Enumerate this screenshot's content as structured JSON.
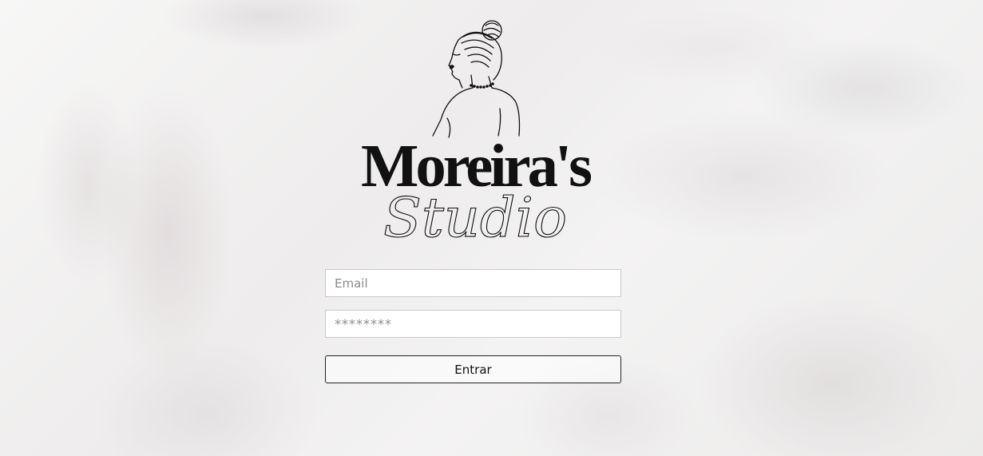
{
  "brand": {
    "name_line1": "Moreira's",
    "name_line2": "Studio"
  },
  "form": {
    "email_placeholder": "Email",
    "password_placeholder": "********",
    "submit_label": "Entrar"
  },
  "colors": {
    "background": "#f5f5f4",
    "logo_ink": "#111111",
    "button_border": "#222222"
  }
}
